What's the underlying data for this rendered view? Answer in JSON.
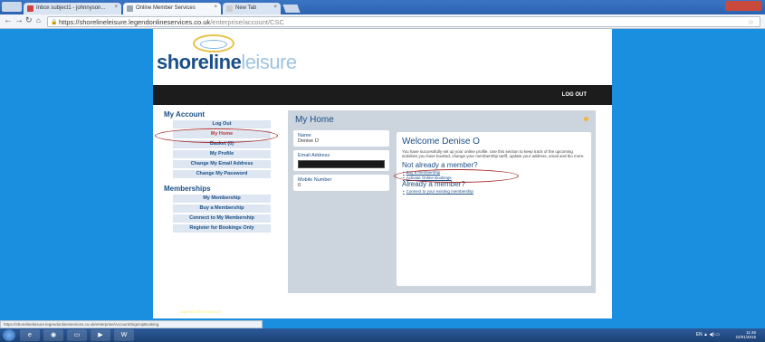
{
  "browser": {
    "tabs": [
      {
        "title": "Inbox subject1 - johnnyson...",
        "favicon_color": "#d04040"
      },
      {
        "title": "Online Member Services",
        "favicon_color": "#9aa7b5"
      },
      {
        "title": "New Tab",
        "favicon_color": "#cccccc"
      }
    ],
    "url_host": "https://shorelineleisure.legendonlineservices.co.uk",
    "url_path": "/enterprise/account/CSC",
    "status_text": "https://shorelineleisure.legendonlineservices.co.uk/enterprise/Account/SignUpBooking"
  },
  "site": {
    "logo_main": "shoreline",
    "logo_sub": "leisure",
    "logout_label": "LOG OUT",
    "footer_prefix": "Powered by",
    "footer_link": "Legend online services"
  },
  "sidebar": {
    "account_heading": "My Account",
    "account_items": [
      {
        "label": "Log Out"
      },
      {
        "label": "My Home"
      },
      {
        "label": "Basket (0)"
      },
      {
        "label": "My Profile"
      },
      {
        "label": "Change My Email Address"
      },
      {
        "label": "Change My Password"
      }
    ],
    "memberships_heading": "Memberships",
    "membership_items": [
      {
        "label": "My Membership"
      },
      {
        "label": "Buy a Membership"
      },
      {
        "label": "Connect to My Membership"
      },
      {
        "label": "Register for Bookings Only"
      }
    ]
  },
  "main": {
    "title": "My Home",
    "name_label": "Name",
    "name_value": "Denise O",
    "email_label": "Email Address",
    "mobile_label": "Mobile Number",
    "mobile_value": "0",
    "welcome_title": "Welcome Denise O",
    "welcome_text": "You have successfully set up your online profile. Use this section to keep track of the upcoming activities you have booked, change your membership tariff, update your address, email and bio more.",
    "not_member_heading": "Not already a member?",
    "not_member_links": [
      "Buy a membership",
      "Activate Online Bookings"
    ],
    "already_member_heading": "Already a member?",
    "already_member_links": [
      "Connect to your existing membership"
    ]
  },
  "taskbar": {
    "lang": "EN",
    "time": "11:46",
    "date": "22/01/2015"
  },
  "colors": {
    "background": "#1a8fe0",
    "brand": "#1b4f86",
    "annotation": "#a92c2c"
  }
}
